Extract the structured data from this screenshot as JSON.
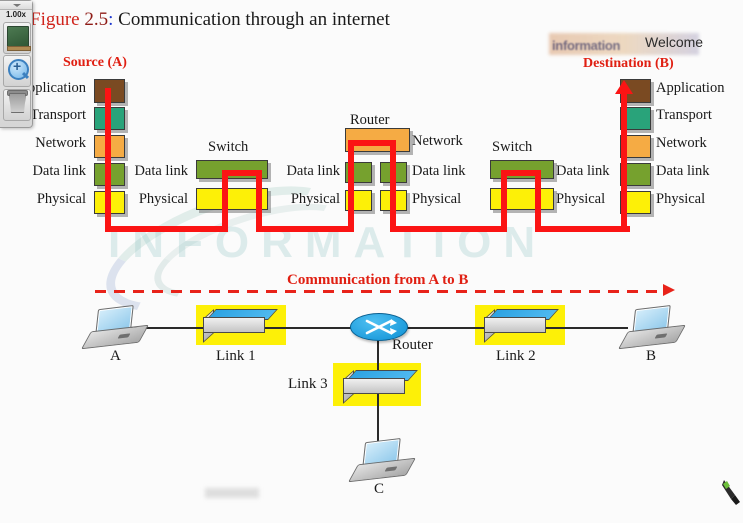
{
  "app": {
    "toolbar": {
      "zoom_level": "1.00x",
      "buttons": [
        {
          "name": "whiteboard",
          "icon": "chalkboard-icon"
        },
        {
          "name": "zoom-in",
          "icon": "magnifier-plus-icon"
        },
        {
          "name": "trash",
          "icon": "trash-icon"
        }
      ]
    },
    "cursor_tool": "pen-cursor",
    "welcome_text": "Welcome",
    "watermark_text": "INFORMATION",
    "watermark_topright": "information"
  },
  "figure": {
    "caption_prefix": "Figure",
    "caption_number": "2.5",
    "caption_colon": ":",
    "caption_text": "Communication through an internet"
  },
  "colors": {
    "application": "#7a4a22",
    "transport": "#29a37a",
    "network": "#f5ab44",
    "datalink": "#76a12e",
    "physical": "#fdf007",
    "path": "#fb1414",
    "heading": "#e01f12",
    "highlight": "#fdf007",
    "router": "#0d8fd4"
  },
  "upper_diagram": {
    "source_heading": "Source (A)",
    "destination_heading": "Destination (B)",
    "source_layers": [
      {
        "label": "Application",
        "color_key": "application"
      },
      {
        "label": "Transport",
        "color_key": "transport"
      },
      {
        "label": "Network",
        "color_key": "network"
      },
      {
        "label": "Data link",
        "color_key": "datalink"
      },
      {
        "label": "Physical",
        "color_key": "physical"
      }
    ],
    "destination_layers": [
      {
        "label": "Application",
        "color_key": "application"
      },
      {
        "label": "Transport",
        "color_key": "transport"
      },
      {
        "label": "Network",
        "color_key": "network"
      },
      {
        "label": "Data link",
        "color_key": "datalink"
      },
      {
        "label": "Physical",
        "color_key": "physical"
      }
    ],
    "switch1": {
      "title": "Switch",
      "layers": [
        {
          "label": "Data link",
          "color_key": "datalink"
        },
        {
          "label": "Physical",
          "color_key": "physical"
        }
      ]
    },
    "router": {
      "title": "Router",
      "network_label": "Network",
      "layers": [
        {
          "label": "Data link",
          "color_key": "datalink"
        },
        {
          "label": "Physical",
          "color_key": "physical"
        }
      ],
      "left_labels": [
        {
          "label": "Data link"
        },
        {
          "label": "Physical"
        }
      ]
    },
    "switch2": {
      "title": "Switch",
      "layers": [
        {
          "label": "Data link",
          "color_key": "datalink"
        },
        {
          "label": "Physical",
          "color_key": "physical"
        }
      ]
    }
  },
  "lower_diagram": {
    "flow_label": "Communication from A to B",
    "nodes": [
      {
        "id": "A",
        "label": "A",
        "type": "laptop"
      },
      {
        "id": "B",
        "label": "B",
        "type": "laptop"
      },
      {
        "id": "C",
        "label": "C",
        "type": "laptop"
      }
    ],
    "links": [
      {
        "label": "Link 1",
        "highlighted": true
      },
      {
        "label": "Link 2",
        "highlighted": true
      },
      {
        "label": "Link 3",
        "highlighted": true
      }
    ],
    "router_label": "Router"
  }
}
